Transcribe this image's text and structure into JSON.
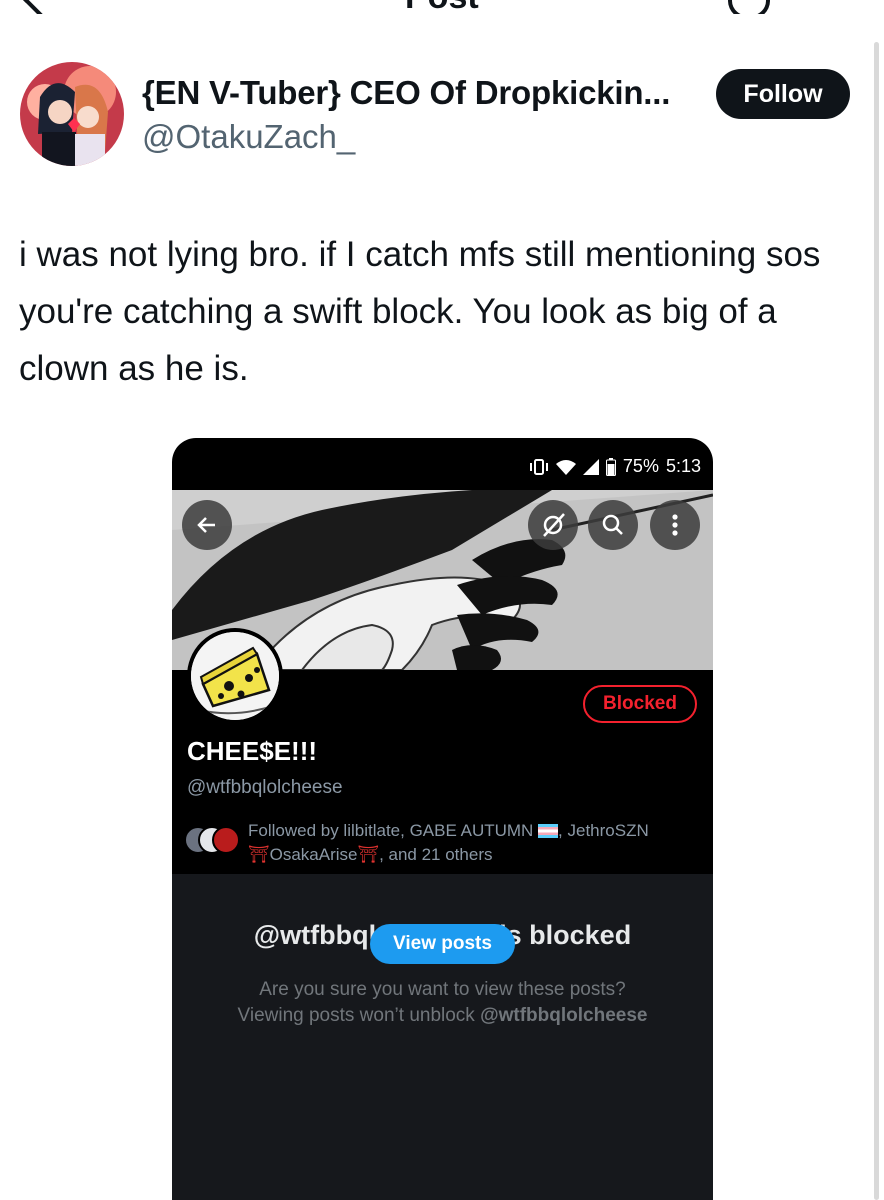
{
  "header": {
    "title": "Post"
  },
  "author": {
    "name": "{EN V-Tuber} CEO Of Dropkickin...",
    "handle": "@OtakuZach_",
    "follow_label": "Follow"
  },
  "post": {
    "text": "i was not lying bro. if I catch mfs still mentioning sos you're catching a swift block. You look as big of a clown as he is."
  },
  "screenshot": {
    "status_bar": {
      "battery": "75%",
      "time": "5:13"
    },
    "profile": {
      "display_name": "CHEE$E!!!",
      "handle": "@wtfbbqlolcheese",
      "blocked_label": "Blocked",
      "followed_by_prefix": "Followed by lilbitlate, GABE AUTUMN ",
      "followed_by_mid": ", JethroSZN ",
      "followed_by_name2": "OsakaArise",
      "followed_by_suffix": ", and 21 others"
    },
    "blocked_notice": {
      "title": "@wtfbbqlolcheese is blocked",
      "line1": "Are you sure you want to view these posts?",
      "line2_prefix": "Viewing posts won’t unblock ",
      "line2_handle": "@wtfbbqlolcheese",
      "button_label": "View posts"
    },
    "accent_red": "#f4212e",
    "accent_blue": "#1d9bf0"
  }
}
